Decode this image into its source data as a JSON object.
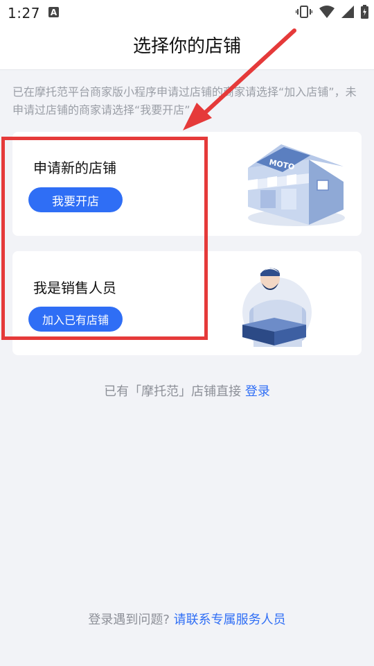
{
  "status_bar": {
    "time": "1:27",
    "notification_icon_letter": "A"
  },
  "header": {
    "title": "选择你的店铺"
  },
  "intro_text": "已在摩托范平台商家版小程序申请过店铺的商家请选择“加入店铺”，未申请过店铺的商家请选择“我要开店”",
  "cards": [
    {
      "title": "申请新的店铺",
      "button_label": "我要开店",
      "illustration": "storefront-illustration"
    },
    {
      "title": "我是销售人员",
      "button_label": "加入已有店铺",
      "illustration": "salesperson-illustration"
    }
  ],
  "store_sign_text": "MOTO",
  "login": {
    "prefix": "已有「摩托范」店铺直接",
    "link_label": "登录"
  },
  "footer": {
    "prefix": "登录遇到问题?",
    "link_label": "请联系专属服务人员"
  },
  "colors": {
    "accent": "#2f6ef5",
    "annotation": "#e53a3a",
    "background": "#f2f3f7"
  }
}
